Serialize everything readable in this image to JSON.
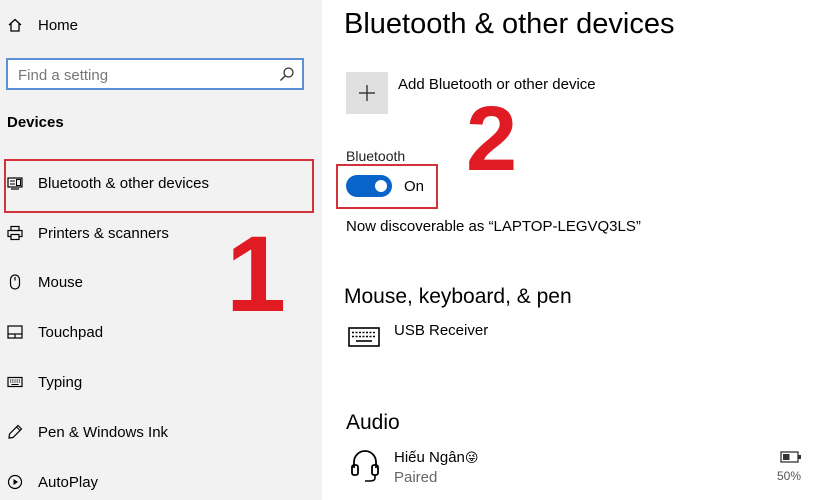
{
  "sidebar": {
    "home_label": "Home",
    "search_placeholder": "Find a setting",
    "section_heading": "Devices",
    "items": [
      {
        "label": "Bluetooth & other devices",
        "icon": "bluetooth-devices-icon",
        "selected": true
      },
      {
        "label": "Printers & scanners",
        "icon": "printer-icon"
      },
      {
        "label": "Mouse",
        "icon": "mouse-icon"
      },
      {
        "label": "Touchpad",
        "icon": "touchpad-icon"
      },
      {
        "label": "Typing",
        "icon": "keyboard-icon"
      },
      {
        "label": "Pen & Windows Ink",
        "icon": "pen-icon"
      },
      {
        "label": "AutoPlay",
        "icon": "autoplay-icon"
      }
    ]
  },
  "main": {
    "title": "Bluetooth & other devices",
    "add_device_label": "Add Bluetooth or other device",
    "bluetooth_heading": "Bluetooth",
    "bluetooth_state": "On",
    "discoverable_text": "Now discoverable as “LAPTOP-LEGVQ3LS”",
    "mouse_keyboard_heading": "Mouse, keyboard, & pen",
    "usb_device_name": "USB Receiver",
    "audio_heading": "Audio",
    "audio_device_name": "Hiếu Ngân",
    "audio_device_emoji": "😜",
    "audio_device_status": "Paired",
    "audio_battery": "50%"
  },
  "annotations": {
    "step_1": "1",
    "step_2": "2"
  },
  "colors": {
    "accent": "#0a63c9",
    "annotation_red": "#e01b23",
    "sidebar_bg": "#f2f2f2"
  }
}
